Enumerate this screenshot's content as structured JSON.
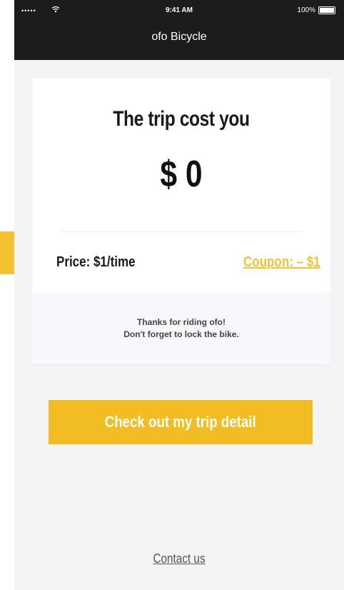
{
  "status_bar": {
    "signal": "•••••",
    "wifi_icon": "wifi-icon",
    "time": "9:41 AM",
    "battery_text": "100%"
  },
  "header": {
    "title": "ofo Bicycle"
  },
  "trip": {
    "title": "The trip cost you",
    "cost": "$ 0",
    "price": "Price: $1/time",
    "coupon": "Coupon: – $1"
  },
  "message": {
    "line1": "Thanks for riding ofo!",
    "line2": "Don't forget to lock the bike."
  },
  "actions": {
    "checkout_label": "Check out my trip detail",
    "contact_label": "Contact us"
  },
  "colors": {
    "accent": "#f2bd22",
    "header_bg": "#1c1c1c",
    "page_bg": "#f4f4f4"
  }
}
